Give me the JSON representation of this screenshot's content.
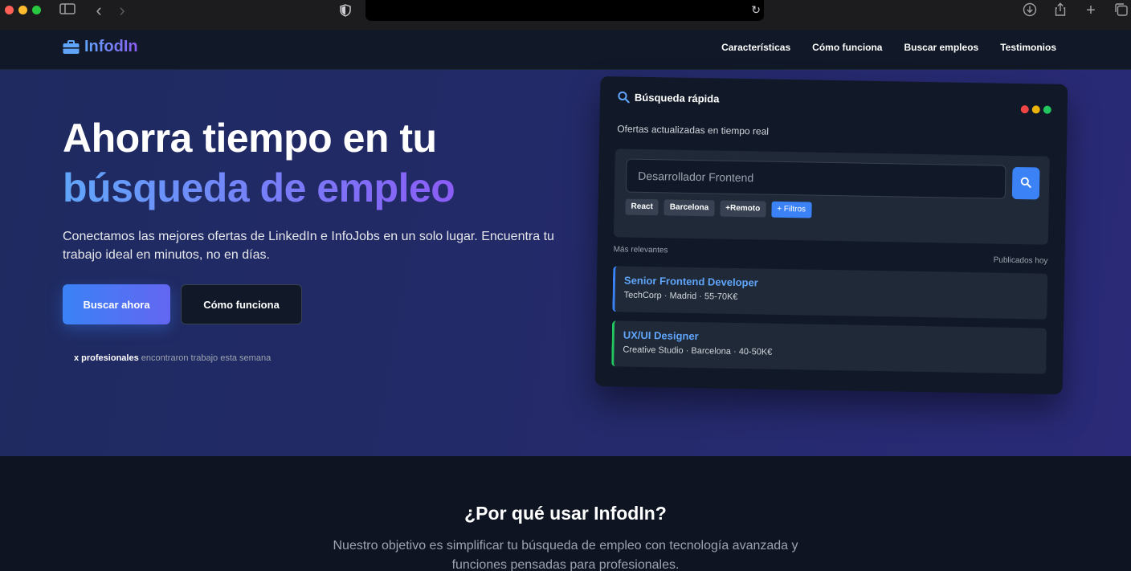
{
  "browser": {
    "back_glyph": "‹",
    "forward_glyph": "›",
    "reload_glyph": "↻",
    "download_glyph": "⤓",
    "share_glyph": "⇪",
    "newtab_glyph": "+",
    "tabs_glyph": "⧉"
  },
  "nav": {
    "brand": "InfodIn",
    "links": [
      "Características",
      "Cómo funciona",
      "Buscar empleos",
      "Testimonios"
    ]
  },
  "hero": {
    "title_line1": "Ahorra tiempo en tu",
    "title_line2": "búsqueda de empleo",
    "lead": "Conectamos las mejores ofertas de LinkedIn e InfoJobs en un solo lugar. Encuentra tu trabajo ideal en minutos, no en días.",
    "primary_button": "Buscar ahora",
    "secondary_button": "Cómo funciona",
    "stat_bold": "x profesionales",
    "stat_rest": " encontraron trabajo esta semana"
  },
  "card": {
    "title": "Búsqueda rápida",
    "subtitle": "Ofertas actualizadas en tiempo real",
    "search_placeholder": "Desarrollador Frontend",
    "tags": [
      "React",
      "Barcelona",
      "+Remoto"
    ],
    "filter_button": "+ Filtros",
    "label_left": "Más relevantes",
    "label_right": "Publicados hoy",
    "jobs": [
      {
        "title": "Senior Frontend Developer",
        "meta": "TechCorp · Madrid · 55-70K€"
      },
      {
        "title": "UX/UI Designer",
        "meta": "Creative Studio · Barcelona · 40-50K€"
      }
    ]
  },
  "section": {
    "title": "¿Por qué usar InfodIn?",
    "subtitle": "Nuestro objetivo es simplificar tu búsqueda de empleo con tecnología avanzada y funciones pensadas para profesionales."
  },
  "colors": {
    "accent": "#3b82f6",
    "accent_purple": "#8b5cf6",
    "job_border_1": "#3b82f6",
    "job_border_2": "#22c55e"
  }
}
